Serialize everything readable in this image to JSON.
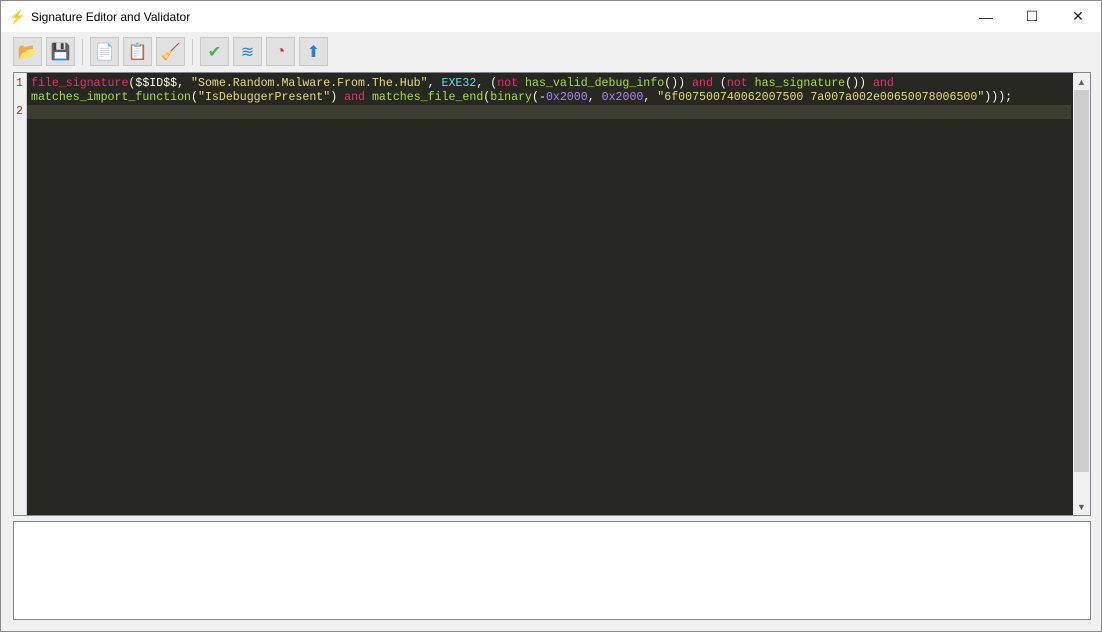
{
  "window": {
    "title": "Signature Editor and Validator",
    "minimize": "—",
    "maximize": "☐",
    "close": "✕"
  },
  "toolbar": [
    {
      "name": "open-folder",
      "icon": "📂",
      "color": "#f5a623"
    },
    {
      "name": "save",
      "icon": "💾",
      "color": "#d9323a"
    },
    {
      "name": "copy",
      "icon": "📄",
      "color": "#2b7fd9"
    },
    {
      "name": "paste",
      "icon": "📋",
      "color": "#2b7fd9"
    },
    {
      "name": "clear-broom",
      "icon": "🧹",
      "color": "#f0a020"
    },
    {
      "name": "validate",
      "icon": "✔",
      "color": "#4caf50"
    },
    {
      "name": "layers",
      "icon": "≋",
      "color": "#2b7fd9"
    },
    {
      "name": "performance",
      "icon": "◔",
      "color": "#d9323a"
    },
    {
      "name": "upload",
      "icon": "⬆",
      "color": "#2b7fd9"
    }
  ],
  "editor": {
    "line_numbers": [
      "1",
      "2"
    ],
    "lines": [
      [
        [
          "file_signature",
          "k"
        ],
        [
          "($$ID$$, ",
          "p"
        ],
        [
          "\"Some.Random.Malware.From.The.Hub\"",
          "s"
        ],
        [
          ", ",
          "p"
        ],
        [
          "EXE32",
          "c"
        ],
        [
          ", (",
          "p"
        ],
        [
          "not",
          "k"
        ],
        [
          " ",
          "p"
        ],
        [
          "has_valid_debug_info",
          "f"
        ],
        [
          "()) ",
          "p"
        ],
        [
          "and",
          "k"
        ],
        [
          " (",
          "p"
        ],
        [
          "not",
          "k"
        ],
        [
          " ",
          "p"
        ],
        [
          "has_signature",
          "f"
        ],
        [
          "()) ",
          "p"
        ],
        [
          "and",
          "k"
        ]
      ],
      [
        [
          "matches_import_function",
          "f"
        ],
        [
          "(",
          "p"
        ],
        [
          "\"IsDebuggerPresent\"",
          "s"
        ],
        [
          ") ",
          "p"
        ],
        [
          "and",
          "k"
        ],
        [
          " ",
          "p"
        ],
        [
          "matches_file_end",
          "f"
        ],
        [
          "(",
          "p"
        ],
        [
          "binary",
          "f"
        ],
        [
          "(-",
          "p"
        ],
        [
          "0x2000",
          "n"
        ],
        [
          ", ",
          "p"
        ],
        [
          "0x2000",
          "n"
        ],
        [
          ", ",
          "p"
        ],
        [
          "\"6f007500740062007500 7a007a002e00650078006500\"",
          "s"
        ],
        [
          ")));",
          "p"
        ]
      ]
    ]
  },
  "output": {
    "text": ""
  }
}
